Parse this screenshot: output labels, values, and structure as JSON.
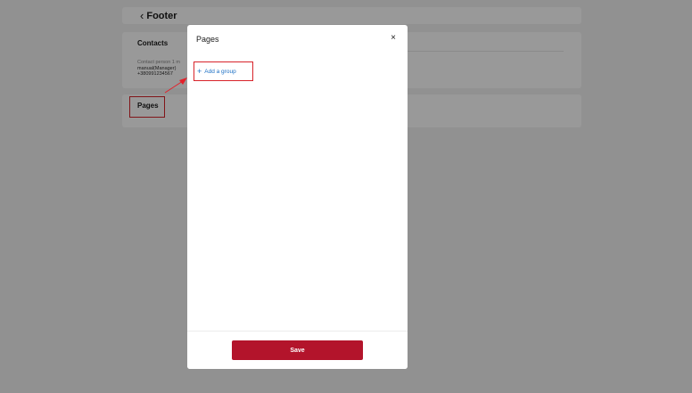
{
  "header": {
    "back_label": "Footer"
  },
  "contacts": {
    "title": "Contacts",
    "line1": "Contact person 1 m",
    "line2": "manual(Manager)",
    "line3": "+380991234567"
  },
  "pages_card": {
    "title": "Pages"
  },
  "modal": {
    "title": "Pages",
    "close_glyph": "×",
    "add_group_label": "Add a group",
    "save_label": "Save"
  },
  "colors": {
    "accent_red": "#b3142b",
    "link_blue": "#1b6fc4",
    "highlight": "#d8232a"
  }
}
